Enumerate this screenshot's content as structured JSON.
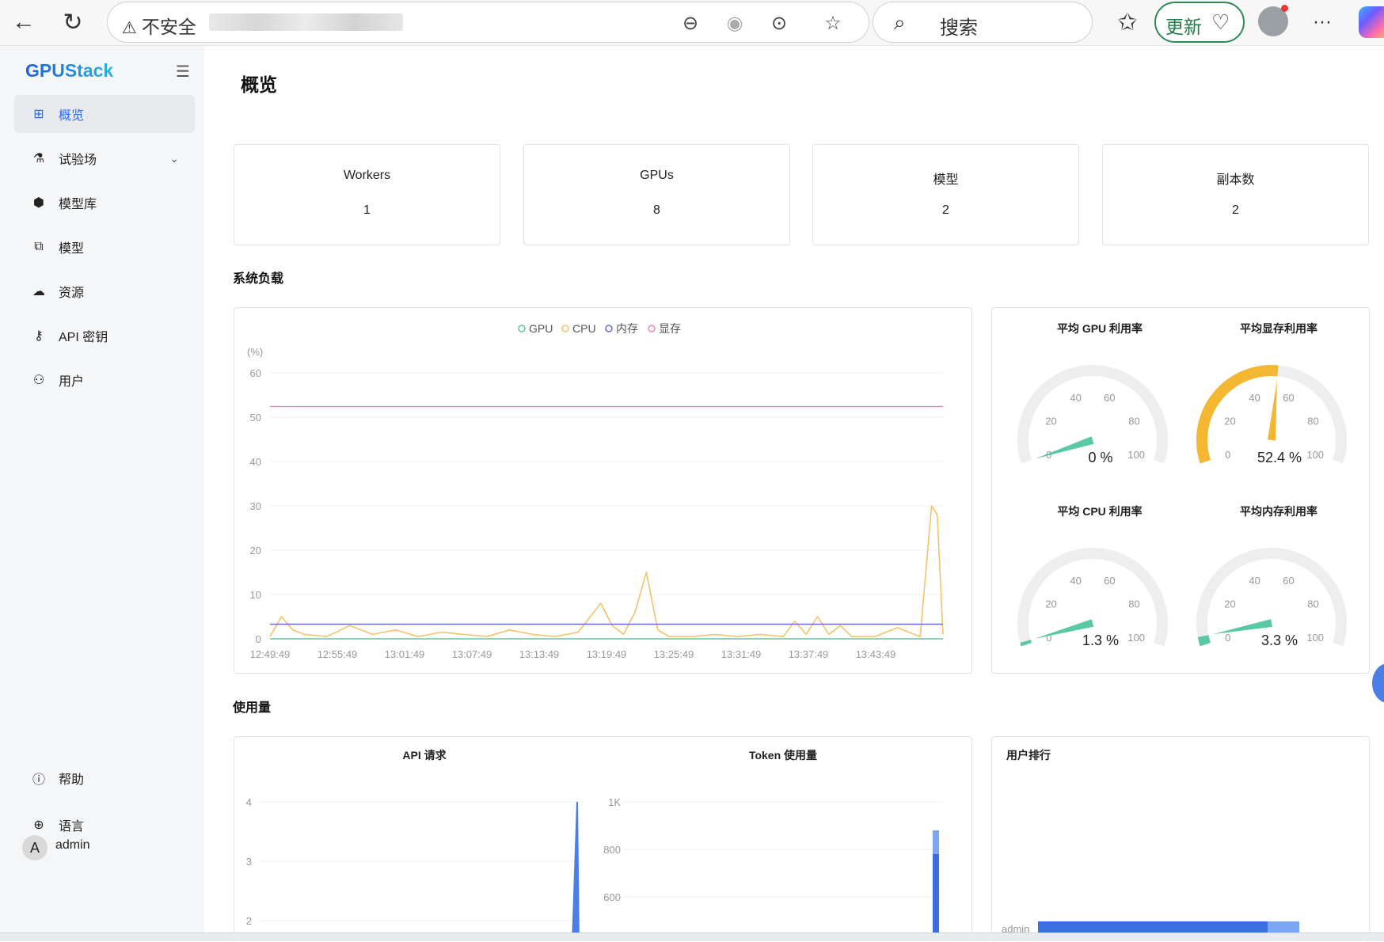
{
  "browser": {
    "insecure_label": "不安全",
    "search_label": "搜索",
    "update_label": "更新"
  },
  "sidebar": {
    "logo": "GPUStack",
    "items": [
      {
        "label": "概览",
        "icon": "grid-icon"
      },
      {
        "label": "试验场",
        "icon": "flask-icon"
      },
      {
        "label": "模型库",
        "icon": "cube-icon"
      },
      {
        "label": "模型",
        "icon": "copy-icon"
      },
      {
        "label": "资源",
        "icon": "cloud-icon"
      },
      {
        "label": "API 密钥",
        "icon": "key-icon"
      },
      {
        "label": "用户",
        "icon": "user-icon"
      }
    ],
    "help_label": "帮助",
    "language_label": "语言",
    "user": {
      "avatar": "A",
      "name": "admin"
    }
  },
  "page": {
    "title": "概览",
    "stats": [
      {
        "label": "Workers",
        "value": "1"
      },
      {
        "label": "GPUs",
        "value": "8"
      },
      {
        "label": "模型",
        "value": "2"
      },
      {
        "label": "副本数",
        "value": "2"
      }
    ],
    "system_load_title": "系统负载",
    "usage_title": "使用量"
  },
  "colors": {
    "gpu": "#5ac8a0",
    "cpu": "#f5c36b",
    "memory": "#6b6bd6",
    "vram": "#f08aa8",
    "accent": "#2f6bf0",
    "gauge_green": "#5ac8a0",
    "gauge_orange": "#f5b731"
  },
  "chart_data": [
    {
      "type": "line",
      "ylabel": "(%)",
      "ylim": [
        0,
        60
      ],
      "yticks": [
        "0",
        "10",
        "20",
        "30",
        "40",
        "50",
        "60"
      ],
      "categories": [
        "12:49:49",
        "12:55:49",
        "13:01:49",
        "13:07:49",
        "13:13:49",
        "13:19:49",
        "13:25:49",
        "13:31:49",
        "13:37:49",
        "13:43:49"
      ],
      "legend": [
        "GPU",
        "CPU",
        "内存",
        "显存"
      ],
      "x_end": 59,
      "series": [
        {
          "name": "GPU",
          "x": [
            0,
            59
          ],
          "values": [
            0,
            0
          ]
        },
        {
          "name": "CPU",
          "x": [
            0,
            1,
            2,
            3,
            5,
            7,
            9,
            11,
            13,
            15,
            17,
            19,
            21,
            23,
            25,
            27,
            29,
            30,
            31,
            32,
            33,
            34,
            35,
            37,
            39,
            41,
            43,
            45,
            46,
            47,
            48,
            49,
            50,
            51,
            53,
            55,
            57,
            58,
            58.5,
            59
          ],
          "values": [
            0.5,
            5,
            2,
            1,
            0.5,
            3,
            1,
            2,
            0.5,
            1.5,
            1,
            0.5,
            2,
            1,
            0.5,
            1.5,
            8,
            3,
            1,
            6,
            15,
            2,
            0.5,
            0.5,
            1,
            0.5,
            1,
            0.5,
            4,
            1,
            5,
            1,
            3,
            0.5,
            0.5,
            2.5,
            0.5,
            30,
            28,
            1
          ]
        },
        {
          "name": "内存",
          "x": [
            0,
            59
          ],
          "values": [
            3.3,
            3.3
          ]
        },
        {
          "name": "显存",
          "x": [
            0,
            59
          ],
          "values": [
            52.4,
            52.4
          ]
        }
      ]
    },
    {
      "type": "gauge",
      "gauges": [
        {
          "title": "平均 GPU 利用率",
          "value": 0,
          "display": "0 %"
        },
        {
          "title": "平均显存利用率",
          "value": 52.4,
          "display": "52.4 %"
        },
        {
          "title": "平均 CPU 利用率",
          "value": 1.3,
          "display": "1.3 %"
        },
        {
          "title": "平均内存利用率",
          "value": 3.3,
          "display": "3.3 %"
        }
      ],
      "ticks": [
        "0",
        "20",
        "40",
        "60",
        "80",
        "100"
      ]
    },
    {
      "type": "bar",
      "title": "API 请求",
      "yticks": [
        "2",
        "3",
        "4"
      ],
      "ylim": [
        1.5,
        4
      ],
      "values": [
        4
      ]
    },
    {
      "type": "bar",
      "title": "Token 使用量",
      "yticks": [
        "600",
        "800",
        "1K"
      ],
      "ylim": [
        400,
        1000
      ],
      "values": [
        880
      ]
    },
    {
      "type": "bar",
      "title": "用户排行",
      "categories": [
        "admin"
      ],
      "values": [
        1
      ]
    }
  ]
}
